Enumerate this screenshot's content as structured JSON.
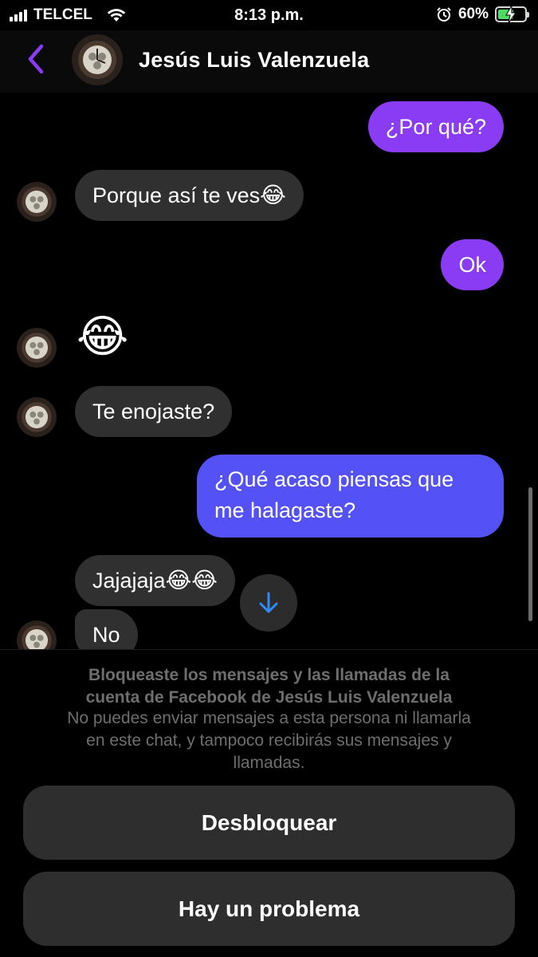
{
  "status_bar": {
    "carrier": "TELCEL",
    "time": "8:13 p.m.",
    "battery": "60%",
    "battery_level": 0.6,
    "icons": [
      "signal-icon",
      "wifi-icon",
      "alarm-icon",
      "battery-charging-icon"
    ]
  },
  "header": {
    "contact_name": "Jesús Luis Valenzuela",
    "back_icon": "chevron-left-icon",
    "accent_color": "#8a3cf4"
  },
  "messages": [
    {
      "side": "out",
      "text": "¿Por qué?"
    },
    {
      "side": "in",
      "text": "Porque así te ves",
      "emoji": "😂"
    },
    {
      "side": "out",
      "text": "Ok"
    },
    {
      "side": "in",
      "emoji_only": "😂"
    },
    {
      "side": "in",
      "text": "Te enojaste?"
    },
    {
      "side": "out",
      "text_line1": "¿Qué acaso piensas que",
      "text_line2": "me halagaste?"
    },
    {
      "side": "in",
      "text": "Jajajaja",
      "emoji": "😂😂"
    },
    {
      "side": "in",
      "text": "No"
    }
  ],
  "scroll_down_icon": "arrow-down-icon",
  "blocked_notice": {
    "title_line1": "Bloqueaste los mensajes y las llamadas de la",
    "title_line2": "cuenta de Facebook de Jesús Luis Valenzuela",
    "body_line1": "No puedes enviar mensajes a esta persona ni llamarla",
    "body_line2": "en este chat, y tampoco recibirás sus mensajes y",
    "body_line3": "llamadas."
  },
  "actions": {
    "unblock_label": "Desbloquear",
    "problem_label": "Hay un problema"
  },
  "colors": {
    "outgoing_purple": "#8a3cf4",
    "outgoing_blue": "#5452f6",
    "incoming_gray": "#303030",
    "scroll_arrow": "#2f8bf5"
  }
}
